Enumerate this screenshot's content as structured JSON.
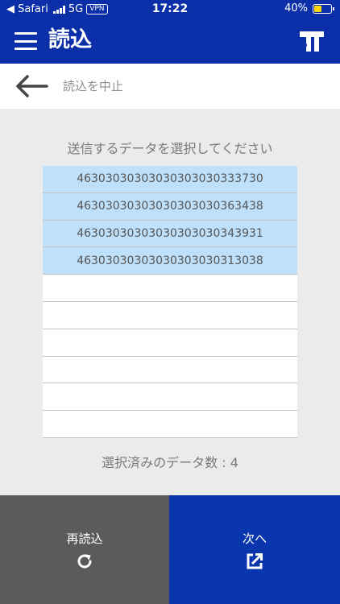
{
  "status_bar": {
    "back_app": "Safari",
    "carrier": "5G",
    "vpn": "VPN",
    "time": "17:22",
    "battery": "40%",
    "battery_level": 0.4
  },
  "header": {
    "title": "読込",
    "menu_icon": "hamburger-icon",
    "logo_icon": "brand-logo"
  },
  "back_bar": {
    "label": "読込を中止",
    "icon": "arrow-left-icon"
  },
  "instruction": "送信するデータを選択してください",
  "data_list": {
    "items": [
      {
        "value": "46303030303030303030333730",
        "selected": true
      },
      {
        "value": "46303030303030303030363438",
        "selected": true
      },
      {
        "value": "46303030303030303030343931",
        "selected": true
      },
      {
        "value": "46303030303030303030313038",
        "selected": true
      },
      {
        "value": "",
        "selected": false
      },
      {
        "value": "",
        "selected": false
      },
      {
        "value": "",
        "selected": false
      },
      {
        "value": "",
        "selected": false
      },
      {
        "value": "",
        "selected": false
      },
      {
        "value": "",
        "selected": false
      }
    ],
    "selected_color": "#bfe0fa"
  },
  "selection_count": "選択済みのデータ数 : 4",
  "buttons": {
    "reread": {
      "label": "再読込",
      "icon": "refresh-icon",
      "color": "#5b5b5b"
    },
    "next": {
      "label": "次へ",
      "icon": "external-link-icon",
      "color": "#0a36ad"
    }
  },
  "colors": {
    "header": "#0a2fa8",
    "background": "#ebebeb"
  }
}
